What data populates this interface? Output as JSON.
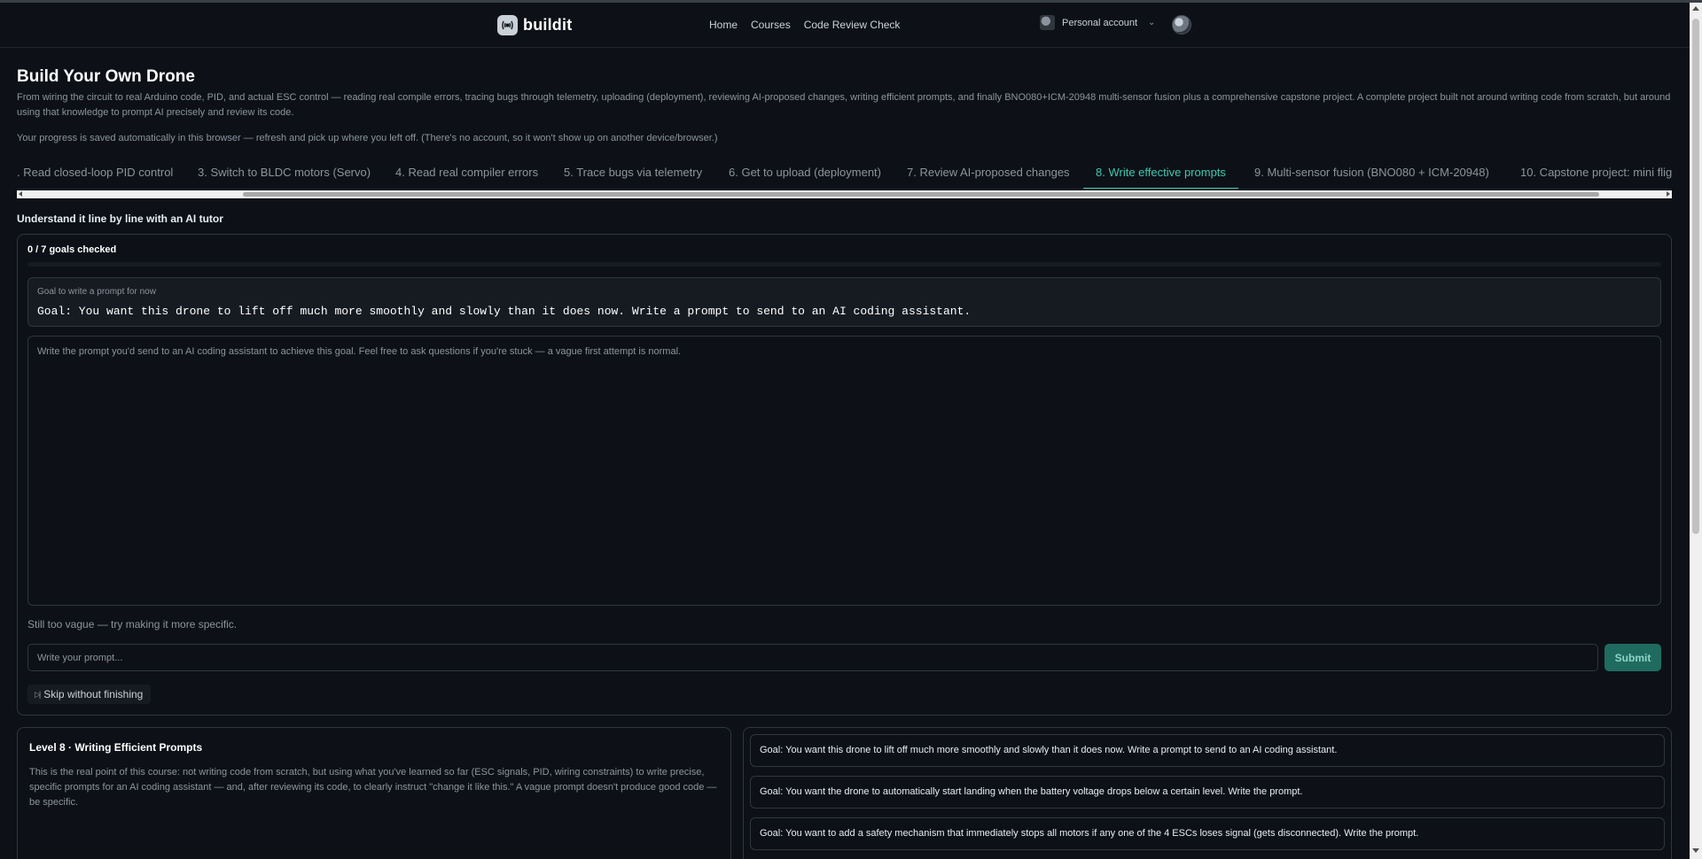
{
  "navbar": {
    "brand": "buildit",
    "links": [
      "Home",
      "Courses",
      "Code Review Check"
    ],
    "account_label": "Personal account"
  },
  "header": {
    "title": "Build Your Own Drone",
    "description": "From wiring the circuit to real Arduino code, PID, and actual ESC control — reading real compile errors, tracing bugs through telemetry, uploading (deployment), reviewing AI-proposed changes, writing efficient prompts, and finally BNO080+ICM-20948 multi-sensor fusion plus a comprehensive capstone project. A complete project built not around writing code from scratch, but around using that knowledge to prompt AI precisely and review its code.",
    "note": "Your progress is saved automatically in this browser — refresh and pick up where you left off. (There's no account, so it won't show up on another device/browser.)"
  },
  "tabs": [
    {
      "label": ". Read closed-loop PID control",
      "active": false
    },
    {
      "label": "3. Switch to BLDC motors (Servo)",
      "active": false
    },
    {
      "label": "4. Read real compiler errors",
      "active": false
    },
    {
      "label": "5. Trace bugs via telemetry",
      "active": false
    },
    {
      "label": "6. Get to upload (deployment)",
      "active": false
    },
    {
      "label": "7. Review AI-proposed changes",
      "active": false
    },
    {
      "label": "8. Write effective prompts",
      "active": true
    },
    {
      "label": "9. Multi-sensor fusion (BNO080 + ICM-20948)",
      "active": false
    },
    {
      "label": "10. Capstone project: mini flig",
      "active": false
    }
  ],
  "tutor": {
    "section_title": "Understand it line by line with an AI tutor",
    "goals_count": "0 / 7 goals checked",
    "goals_progress": 0,
    "goal_label": "Goal to write a prompt for now",
    "goal_text": "Goal: You want this drone to lift off much more smoothly and slowly than it does now. Write a prompt to send to an AI coding assistant.",
    "prompt_placeholder": "Write the prompt you'd send to an AI coding assistant to achieve this goal. Feel free to ask questions if you're stuck — a vague first attempt is normal.",
    "feedback": "Still too vague — try making it more specific.",
    "input_placeholder": "Write your prompt...",
    "submit_label": "Submit",
    "skip_label": "Skip without finishing"
  },
  "level": {
    "title": "Level 8 · Writing Efficient Prompts",
    "description": "This is the real point of this course: not writing code from scratch, but using what you've learned so far (ESC signals, PID, wiring constraints) to write precise, specific prompts for an AI coding assistant — and, after reviewing its code, to clearly instruct \"change it like this.\" A vague prompt doesn't produce good code — be specific."
  },
  "goal_list": [
    "Goal: You want this drone to lift off much more smoothly and slowly than it does now. Write a prompt to send to an AI coding assistant.",
    "Goal: You want the drone to automatically start landing when the battery voltage drops below a certain level. Write the prompt.",
    "Goal: You want to add a safety mechanism that immediately stops all motors if any one of the 4 ESCs loses signal (gets disconnected). Write the prompt."
  ],
  "colors": {
    "background": "#0d1117",
    "accent": "#3fc7b0",
    "submit": "#1f6b60"
  }
}
